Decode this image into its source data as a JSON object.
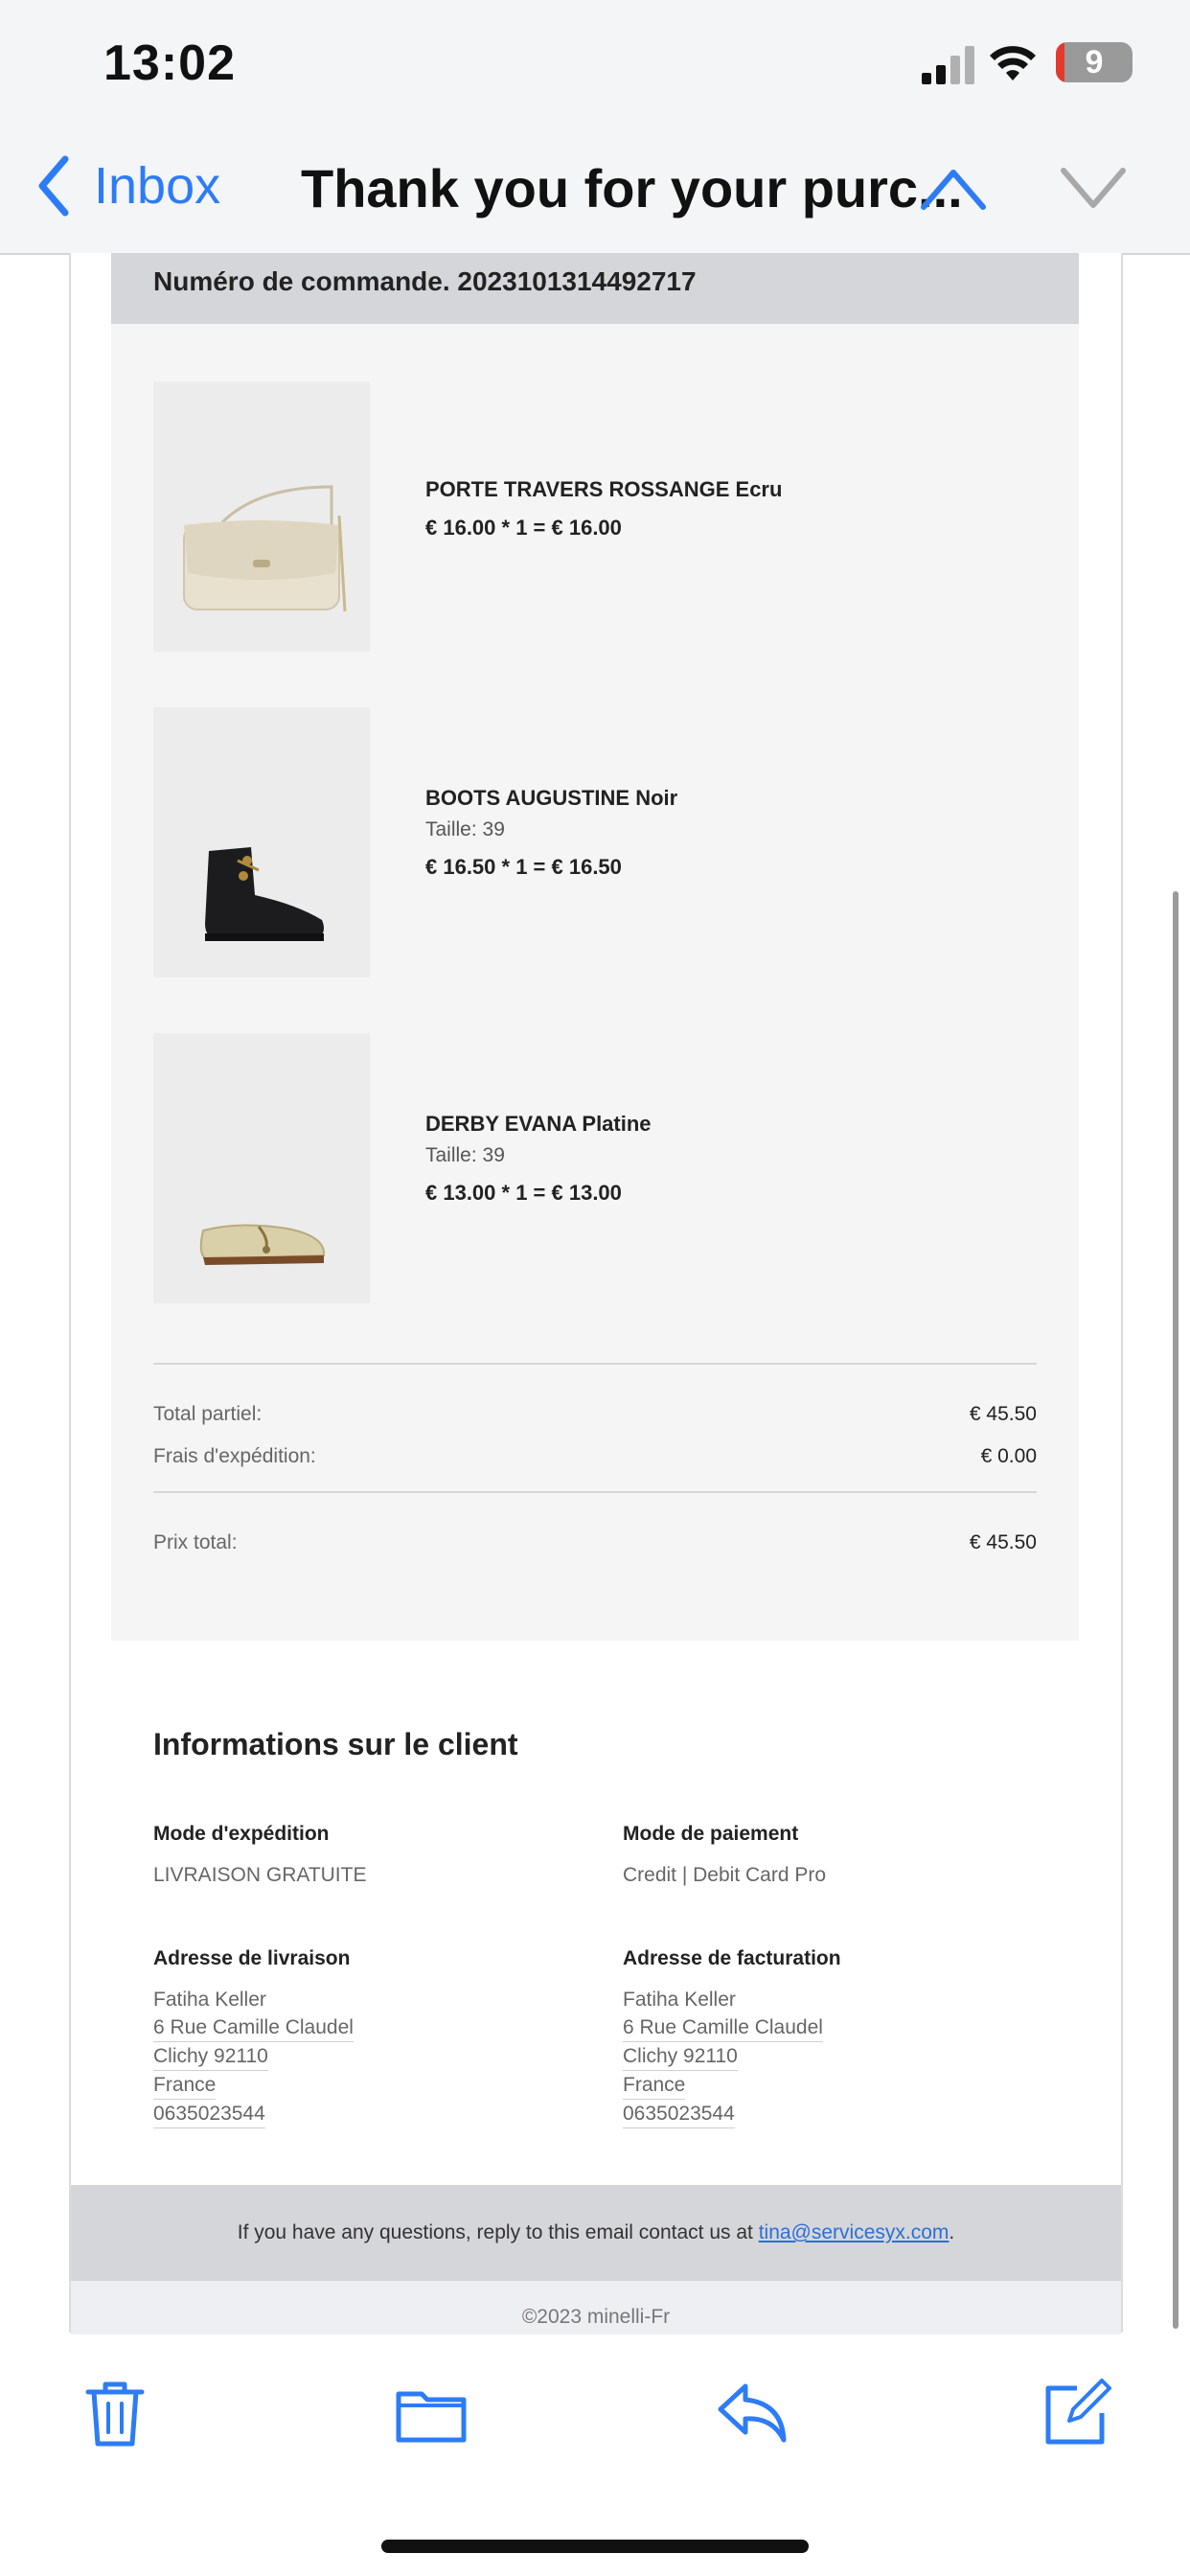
{
  "status_bar": {
    "time": "13:02",
    "battery": "9"
  },
  "nav": {
    "back_label": "Inbox",
    "title": "Thank you for your purc..."
  },
  "order": {
    "number_label": "Numéro de commande. 2023101314492717",
    "items": [
      {
        "name": "PORTE TRAVERS ROSSANGE Ecru",
        "size": "",
        "price": "€ 16.00 * 1 = € 16.00"
      },
      {
        "name": "BOOTS AUGUSTINE Noir",
        "size": "Taille: 39",
        "price": "€ 16.50 * 1 = € 16.50"
      },
      {
        "name": "DERBY EVANA Platine",
        "size": "Taille: 39",
        "price": "€ 13.00 * 1 = € 13.00"
      }
    ],
    "summary": {
      "subtotal_label": "Total partiel:",
      "subtotal": "€ 45.50",
      "shipping_label": "Frais d'expédition:",
      "shipping": "€ 0.00",
      "total_label": "Prix total:",
      "total": "€ 45.50"
    }
  },
  "client": {
    "title": "Informations sur le client",
    "shipping_method_label": "Mode d'expédition",
    "shipping_method": "LIVRAISON GRATUITE",
    "payment_method_label": "Mode de paiement",
    "payment_method": "Credit | Debit Card Pro",
    "delivery_address_label": "Adresse de livraison",
    "billing_address_label": "Adresse de facturation",
    "delivery_address": [
      "Fatiha Keller",
      "6 Rue Camille Claudel",
      "Clichy 92110",
      "France",
      "0635023544"
    ],
    "billing_address": [
      "Fatiha Keller",
      "6 Rue Camille Claudel",
      "Clichy 92110",
      "France",
      "0635023544"
    ]
  },
  "footer": {
    "question_text": "If you have any questions, reply to this email contact us at ",
    "email": "tina@servicesyx.com",
    "copyright": "©2023 minelli-Fr"
  },
  "colors": {
    "accent": "#2d7cf6",
    "header_band": "#d5d6d9",
    "order_bg": "#f5f5f5"
  }
}
